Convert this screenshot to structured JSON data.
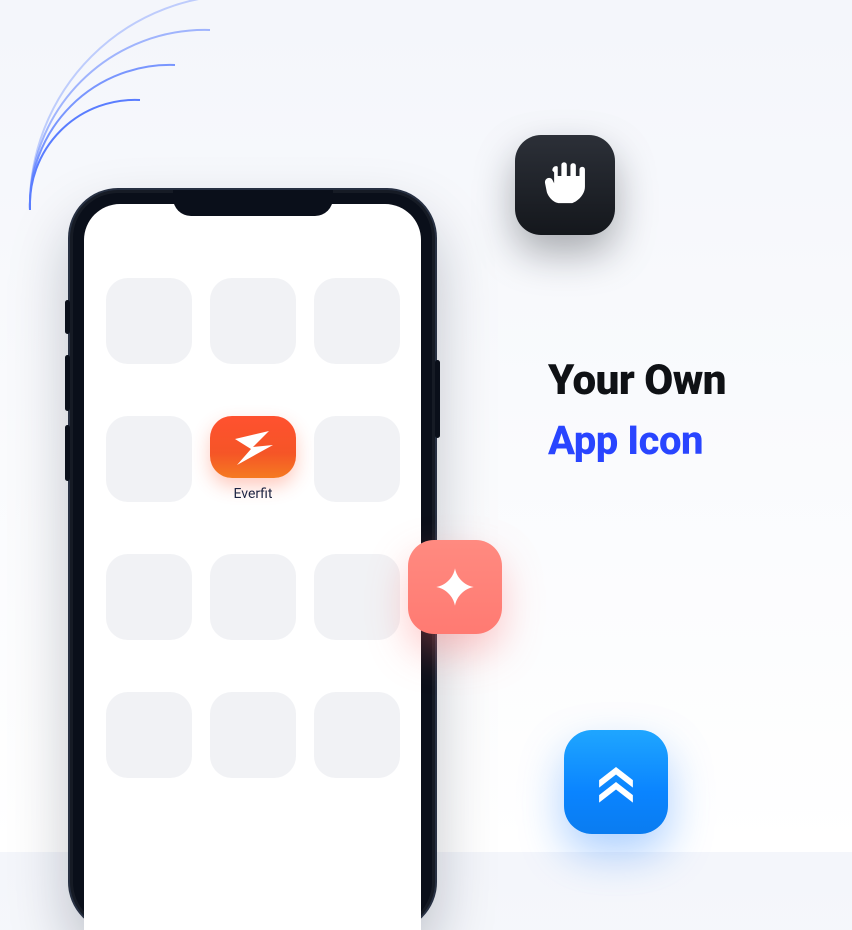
{
  "headline": {
    "line1": "Your Own",
    "line2": "App Icon"
  },
  "phone": {
    "app_name": "Everfit"
  },
  "floating_icons": {
    "fist": "fist-icon",
    "spark": "spark-icon",
    "chevrons": "chevrons-icon"
  },
  "colors": {
    "accent_blue": "#2945ff",
    "everfit_top": "#ff512f",
    "everfit_bottom": "#f57a21"
  }
}
